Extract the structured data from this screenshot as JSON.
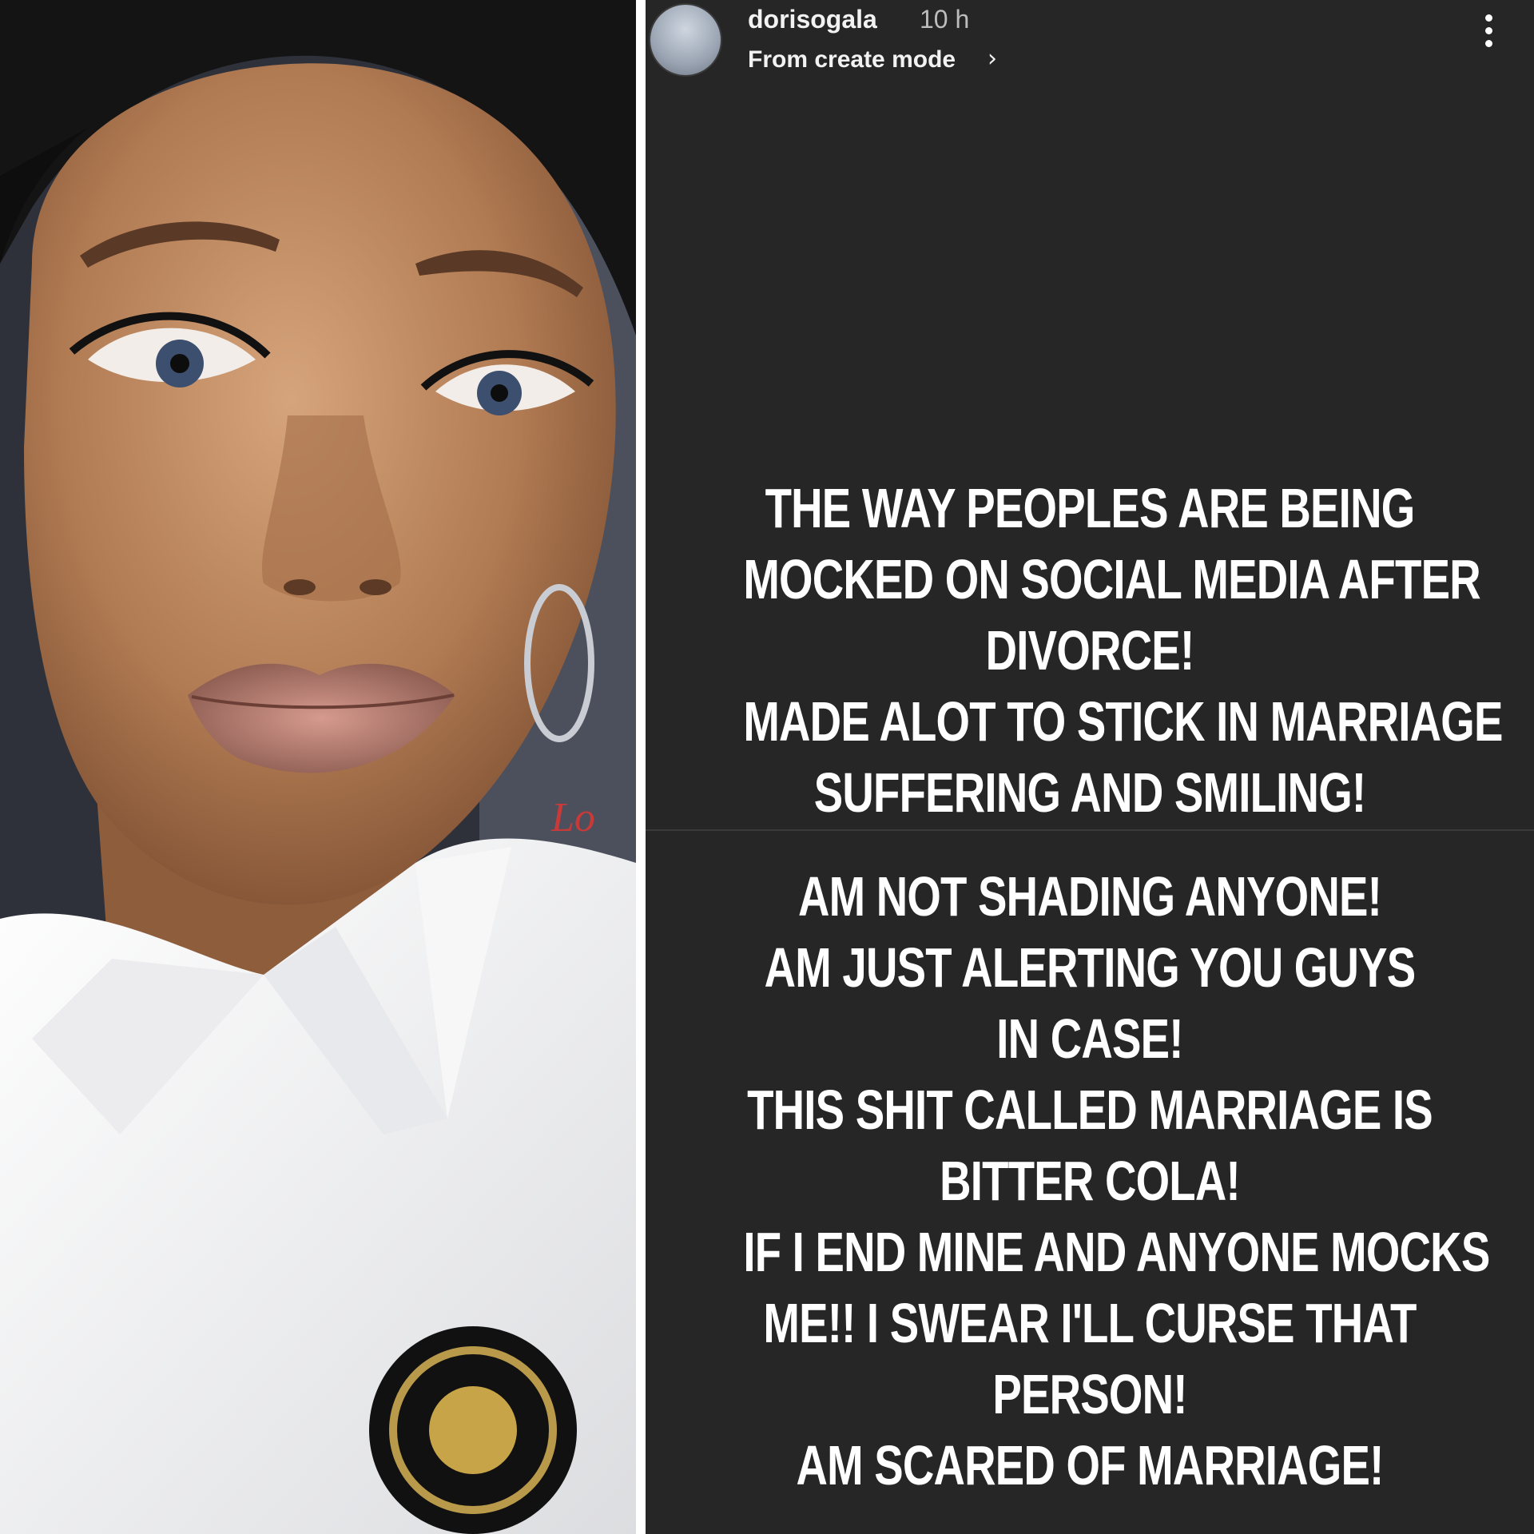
{
  "story": {
    "username": "dorisogala",
    "time": "10 h",
    "subtitle": "From create mode",
    "chevron": "›",
    "block1": [
      "THE WAY PEOPLES ARE BEING",
      "MOCKED ON SOCIAL MEDIA AFTER",
      "DIVORCE!",
      "MADE ALOT TO STICK IN MARRIAGE",
      "SUFFERING AND SMILING!"
    ],
    "block2": [
      "AM NOT SHADING ANYONE!",
      "AM JUST ALERTING YOU GUYS",
      "IN CASE!",
      "THIS SHIT CALLED MARRIAGE IS",
      "BITTER COLA!",
      "IF I END MINE AND ANYONE MOCKS",
      "ME!! I SWEAR I'LL CURSE THAT",
      "PERSON!",
      "AM SCARED OF MARRIAGE!"
    ]
  },
  "photo": {
    "label": "Lo"
  },
  "colors": {
    "story_background": "#262626",
    "text": "#ffffff",
    "skin": "#b07a52",
    "shirt": "#f4f4f4"
  },
  "icons": [
    "more-vertical-icon",
    "chevron-right-icon"
  ]
}
